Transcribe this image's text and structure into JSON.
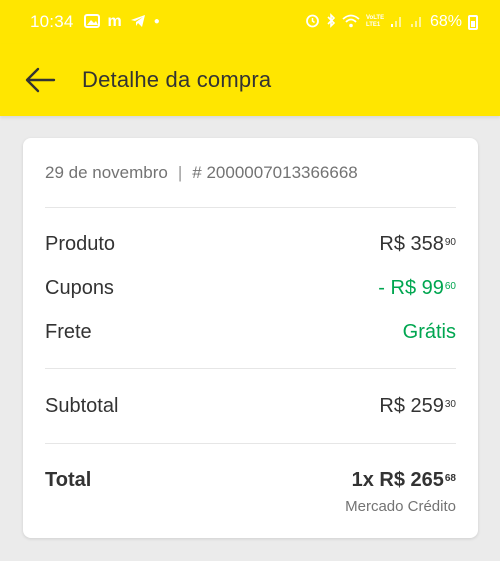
{
  "status_bar": {
    "time": "10:34",
    "left_icons": [
      "gallery-icon",
      "m-app-icon",
      "telegram-icon",
      "dot-icon"
    ],
    "network": "VoLTE LTE1",
    "battery": "68%"
  },
  "app_bar": {
    "title": "Detalhe da compra",
    "background": "#ffe600"
  },
  "purchase": {
    "date": "29 de novembro",
    "separator": "|",
    "order_number": "# 2000007013366668",
    "rows": [
      {
        "label": "Produto",
        "value_main": "R$ 358",
        "value_cents": "90",
        "color": "#333333"
      },
      {
        "label": "Cupons",
        "value_main": "- R$ 99",
        "value_cents": "60",
        "color": "#00a650"
      },
      {
        "label": "Frete",
        "value_main": "Grátis",
        "value_cents": "",
        "color": "#00a650"
      }
    ],
    "subtotal": {
      "label": "Subtotal",
      "value_main": "R$ 259",
      "value_cents": "30"
    },
    "total": {
      "label": "Total",
      "value_main": "1x R$ 265",
      "value_cents": "68",
      "payment_method": "Mercado Crédito"
    }
  }
}
